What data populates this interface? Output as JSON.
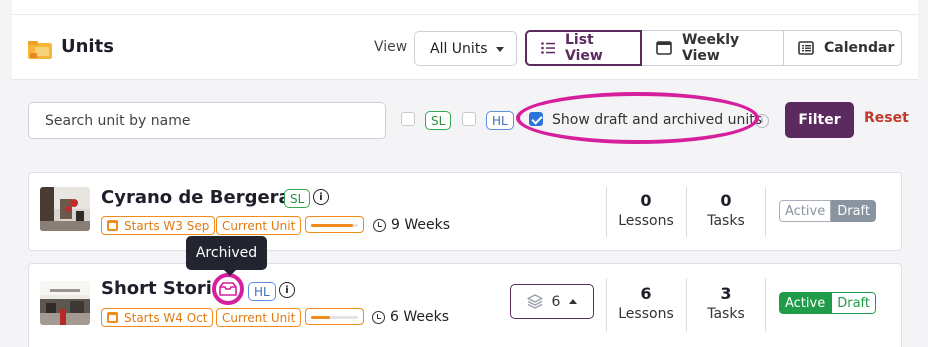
{
  "header": {
    "title": "Units",
    "view_label": "View",
    "select_value": "All Units",
    "views": [
      {
        "label": "List View",
        "icon": "list-icon",
        "active": true
      },
      {
        "label": "Weekly View",
        "icon": "window-icon",
        "active": false
      },
      {
        "label": "Calendar",
        "icon": "calendar-list-icon",
        "active": false
      }
    ]
  },
  "filters": {
    "search_placeholder": "Search unit by name",
    "sl_tag": "SL",
    "hl_tag": "HL",
    "show_draft_label": "Show draft and archived units",
    "show_draft_checked": true,
    "filter_button": "Filter",
    "reset_button": "Reset"
  },
  "tooltip": "Archived",
  "units": [
    {
      "title": "Cyrano de Bergerac",
      "level": "SL",
      "starts": "Starts W3 Sep",
      "status": "Current Unit",
      "progress": 0.9,
      "duration": "9 Weeks",
      "lessons": "0",
      "lessons_label": "Lessons",
      "tasks": "0",
      "tasks_label": "Tasks",
      "toggle_active": "Active",
      "toggle_draft": "Draft",
      "state": "draft"
    },
    {
      "title": "Short Stories",
      "level": "HL",
      "starts": "Starts W4 Oct",
      "status": "Current Unit",
      "progress": 0.4,
      "duration": "6 Weeks",
      "layers_count": "6",
      "lessons": "6",
      "lessons_label": "Lessons",
      "tasks": "3",
      "tasks_label": "Tasks",
      "toggle_active": "Active",
      "toggle_draft": "Draft",
      "state": "active"
    }
  ],
  "colors": {
    "brand": "#5b2a5f",
    "orange": "#f08c1c",
    "highlight": "#d61f9d",
    "active_green": "#1f9c4a",
    "reset_red": "#c0392b"
  }
}
